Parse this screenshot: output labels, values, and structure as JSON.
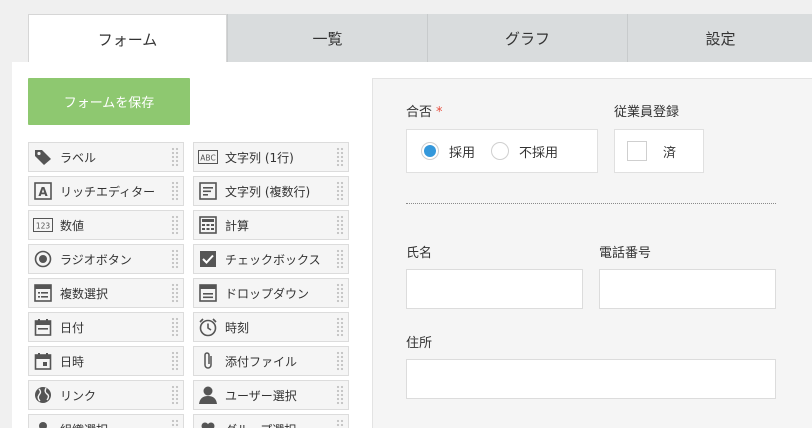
{
  "tabs": [
    {
      "label": "フォーム",
      "active": true
    },
    {
      "label": "一覧",
      "active": false
    },
    {
      "label": "グラフ",
      "active": false
    },
    {
      "label": "設定",
      "active": false
    }
  ],
  "palette": {
    "save_label": "フォームを保存",
    "fields": [
      {
        "label": "ラベル",
        "icon": "tag-icon"
      },
      {
        "label": "文字列 (1行)",
        "icon": "text-abc-icon"
      },
      {
        "label": "リッチエディター",
        "icon": "rich-editor-icon"
      },
      {
        "label": "文字列 (複数行)",
        "icon": "text-multiline-icon"
      },
      {
        "label": "数値",
        "icon": "number-icon"
      },
      {
        "label": "計算",
        "icon": "calculator-icon"
      },
      {
        "label": "ラジオボタン",
        "icon": "radio-icon"
      },
      {
        "label": "チェックボックス",
        "icon": "checkbox-icon"
      },
      {
        "label": "複数選択",
        "icon": "multi-select-icon"
      },
      {
        "label": "ドロップダウン",
        "icon": "dropdown-icon"
      },
      {
        "label": "日付",
        "icon": "date-icon"
      },
      {
        "label": "時刻",
        "icon": "clock-icon"
      },
      {
        "label": "日時",
        "icon": "datetime-icon"
      },
      {
        "label": "添付ファイル",
        "icon": "paperclip-icon"
      },
      {
        "label": "リンク",
        "icon": "globe-icon"
      },
      {
        "label": "ユーザー選択",
        "icon": "user-icon"
      },
      {
        "label": "組織選択",
        "icon": "org-icon"
      },
      {
        "label": "グループ選択",
        "icon": "group-icon"
      }
    ]
  },
  "form": {
    "pass_label": "合否",
    "required_mark": "*",
    "radio_options": [
      {
        "label": "採用",
        "selected": true
      },
      {
        "label": "不採用",
        "selected": false
      }
    ],
    "employee_label": "従業員登録",
    "employee_option": "済",
    "name_label": "氏名",
    "phone_label": "電話番号",
    "address_label": "住所"
  },
  "colors": {
    "save_button": "#8ec870",
    "radio_selected": "#3498db",
    "required": "#e74c3c"
  }
}
